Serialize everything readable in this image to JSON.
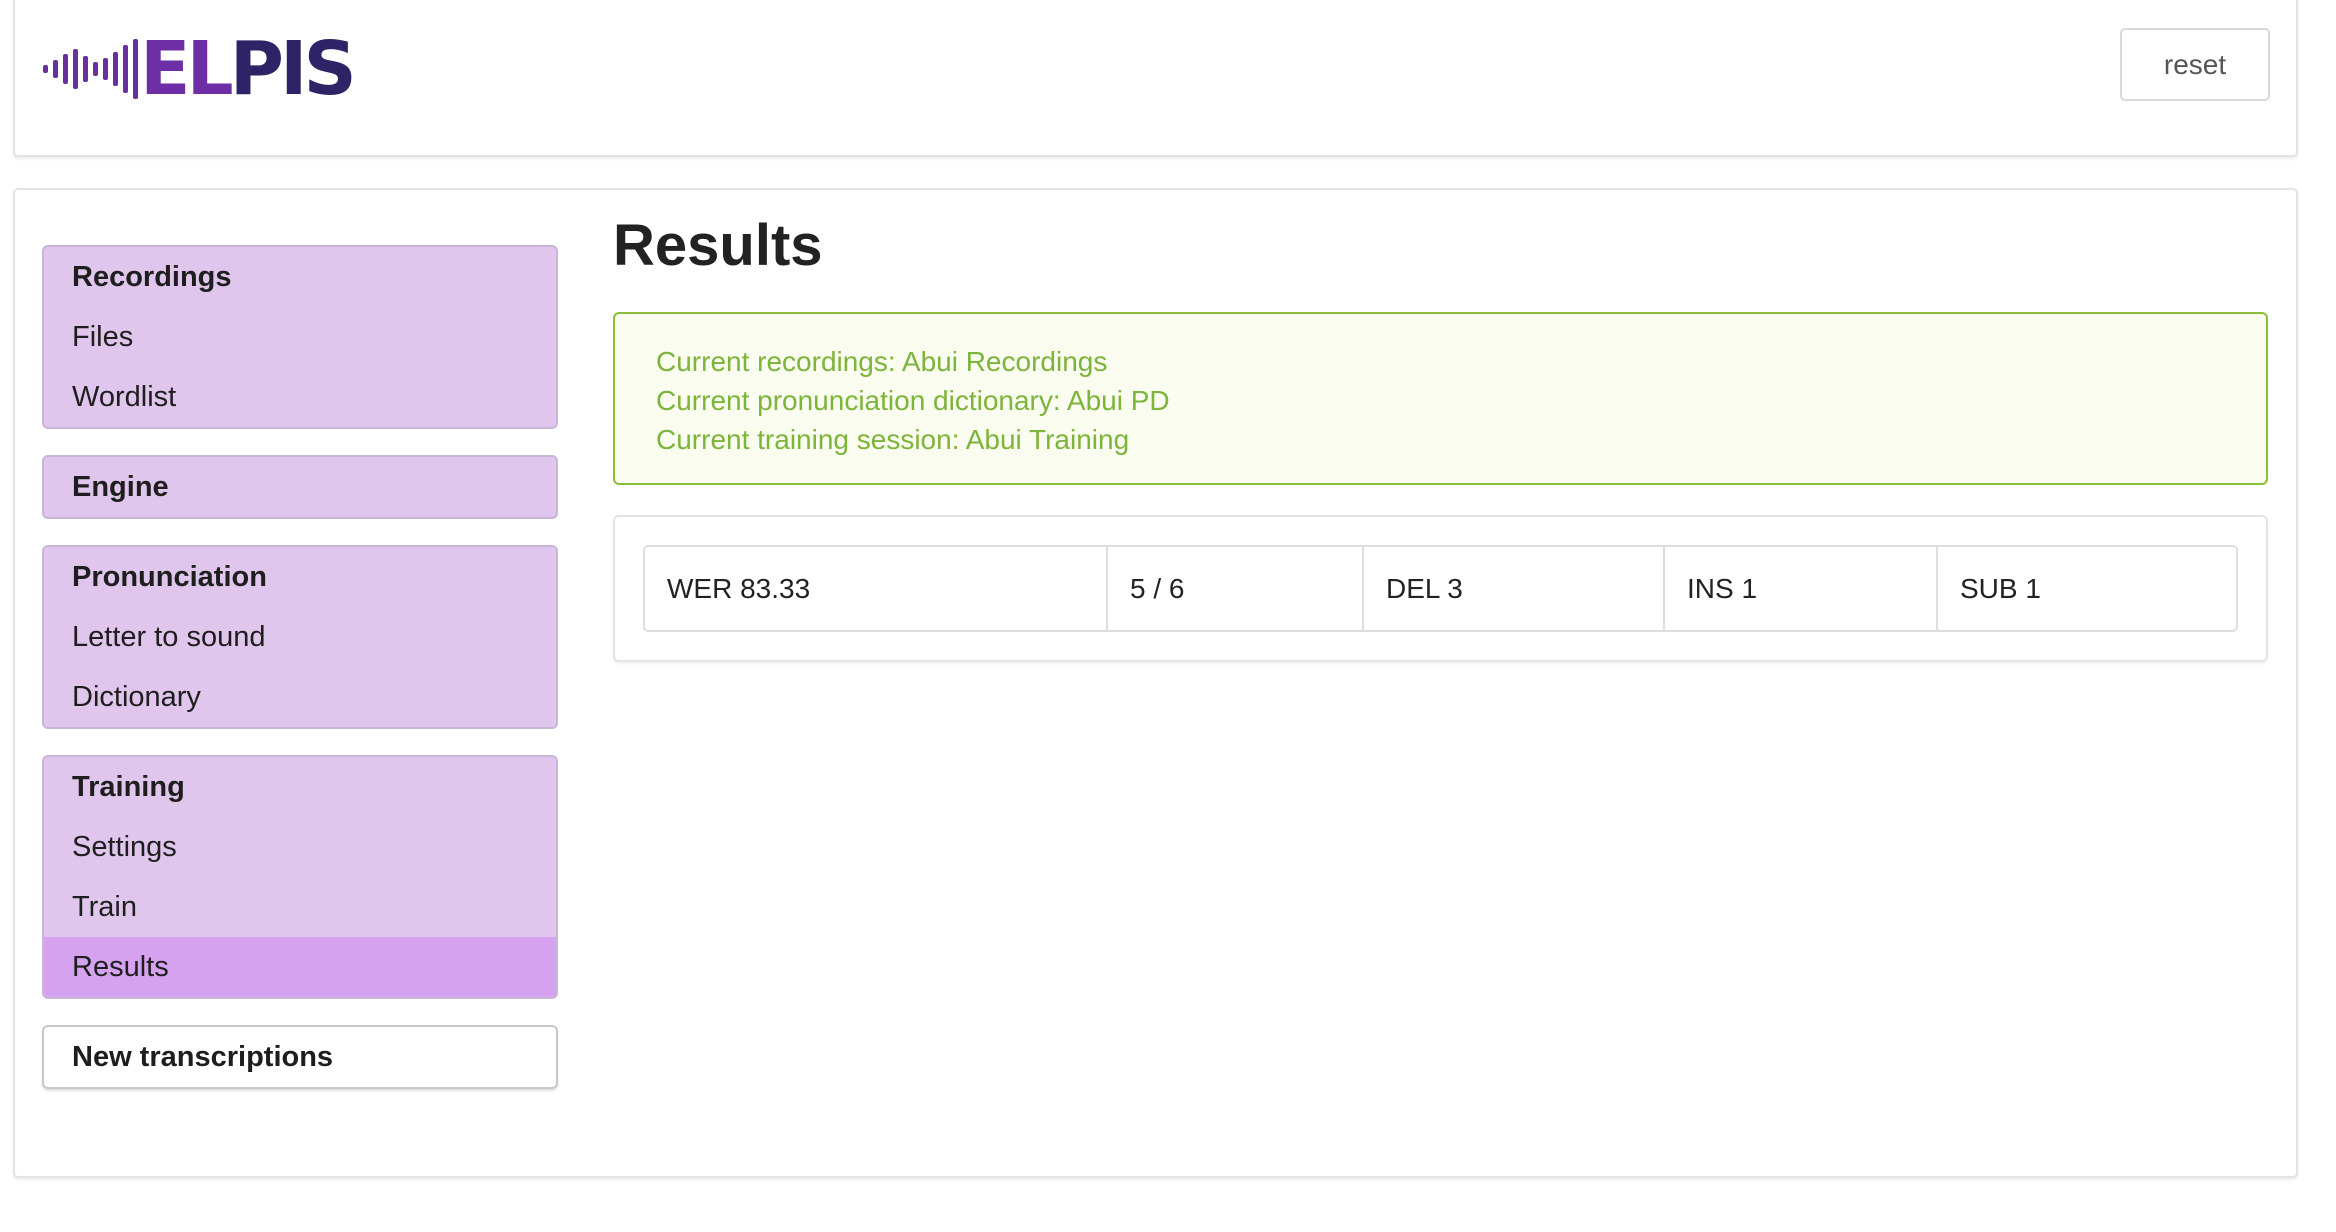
{
  "header": {
    "logo_text_left": "EL",
    "logo_text_right": "PIS",
    "reset_label": "reset"
  },
  "sidebar": {
    "groups": [
      {
        "title": "Recordings",
        "items": [
          "Files",
          "Wordlist"
        ]
      },
      {
        "title": "Engine",
        "items": []
      },
      {
        "title": "Pronunciation",
        "items": [
          "Letter to sound",
          "Dictionary"
        ]
      },
      {
        "title": "Training",
        "items": [
          "Settings",
          "Train",
          "Results"
        ]
      },
      {
        "title": "New transcriptions",
        "items": []
      }
    ],
    "active_item": "Results"
  },
  "main": {
    "title": "Results",
    "info": {
      "recordings": "Current recordings: Abui Recordings",
      "dictionary": "Current pronunciation dictionary: Abui PD",
      "training": "Current training session: Abui Training"
    },
    "results": {
      "wer": "WER 83.33",
      "ratio": "5 / 6",
      "del": "DEL 3",
      "ins": "INS 1",
      "sub": "SUB 1"
    }
  },
  "colors": {
    "logo_dark": "#2e2366",
    "logo_accent": "#6d2ea6",
    "menu_bg": "#e0c6ec",
    "menu_active": "#d5a2f0",
    "info_text": "#7db43a",
    "info_border": "#8bbf3a"
  }
}
